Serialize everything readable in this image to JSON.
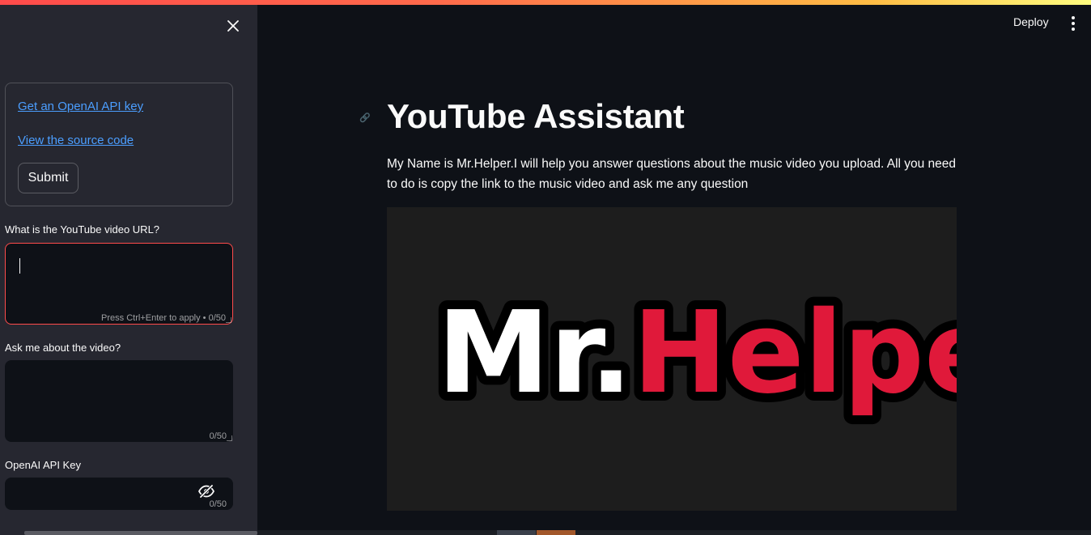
{
  "colors": {
    "accent": "#ff4b4b",
    "link": "#4b9eff",
    "background": "#0e1117",
    "sidebar_bg": "#262730",
    "logo_white": "#ffffff",
    "logo_red": "#e0193a"
  },
  "sidebar": {
    "close_icon": "close-icon",
    "links": [
      {
        "label": "Get an OpenAI API key"
      },
      {
        "label": "View the source code"
      }
    ],
    "submit_label": "Submit",
    "url_field": {
      "label": "What is the YouTube video URL?",
      "value": "",
      "hint": "Press Ctrl+Enter to apply • 0/50"
    },
    "question_field": {
      "label": "Ask me about the video?",
      "value": "",
      "hint": "0/50"
    },
    "api_key_field": {
      "label": "OpenAI API Key",
      "value": "",
      "hint": "0/50",
      "toggle_icon": "eye-off-icon"
    }
  },
  "header": {
    "deploy_label": "Deploy",
    "menu_icon": "kebab-menu-icon"
  },
  "main": {
    "title": "YouTube Assistant",
    "anchor_icon": "link-icon",
    "description": "My Name is Mr.Helper.I will help you answer questions about the music video you upload. All you need to do is copy the link to the music video and ask me any question",
    "image": {
      "logo_part1": "Mr.",
      "logo_part2": "Helper"
    }
  }
}
